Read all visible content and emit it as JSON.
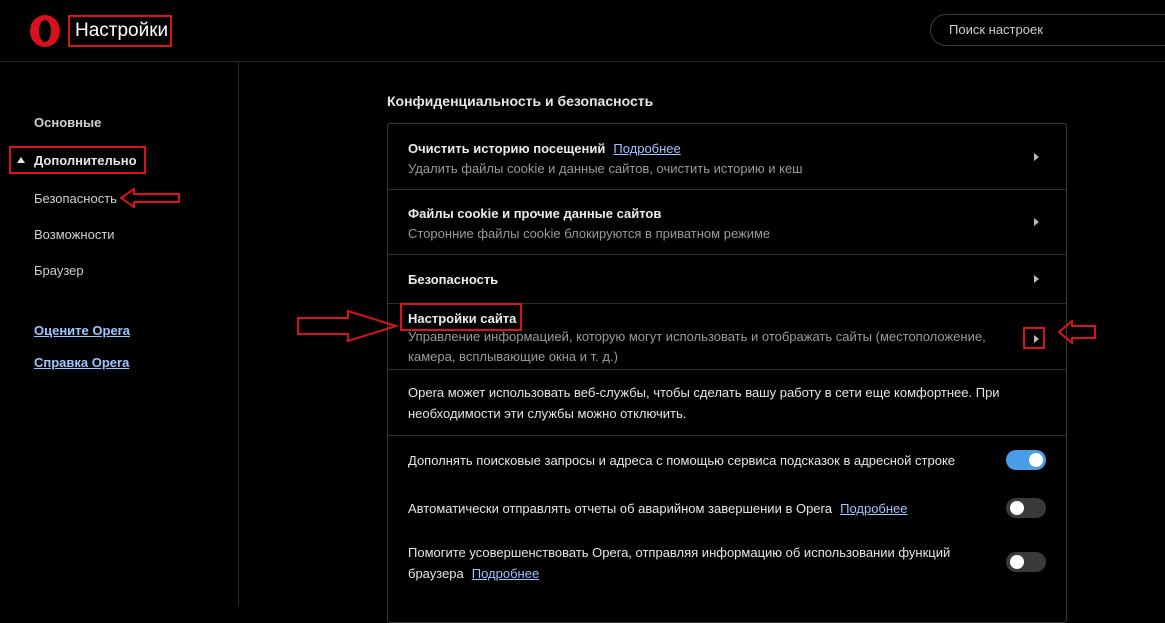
{
  "header": {
    "logo_icon": "opera-logo",
    "title": "Настройки",
    "search_placeholder": "Поиск настроек"
  },
  "sidebar": {
    "basic": "Основные",
    "advanced": "Дополнительно",
    "sub_items": [
      "Безопасность",
      "Возможности",
      "Браузер"
    ],
    "links": [
      "Оцените Opera",
      "Справка Opera"
    ]
  },
  "section": {
    "title": "Конфиденциальность и безопасность",
    "rows": {
      "clear_history": {
        "title": "Очистить историю посещений",
        "link": "Подробнее",
        "desc": "Удалить файлы cookie и данные сайтов, очистить историю и кеш"
      },
      "cookies": {
        "title": "Файлы cookie и прочие данные сайтов",
        "desc": "Сторонние файлы cookie блокируются в приватном режиме"
      },
      "security": {
        "title": "Безопасность"
      },
      "site_settings": {
        "title": "Настройки сайта",
        "desc_line1": "Управление информацией, которую могут использовать и отображать сайты (местоположение,",
        "desc_line2": "камера, всплывающие окна и т. д.)"
      },
      "web_services": {
        "line1": "Opera может использовать веб-службы, чтобы сделать вашу работу в сети еще комфортнее. При",
        "line2": "необходимости эти службы можно отключить."
      },
      "suggestions": {
        "text": "Дополнять поисковые запросы и адреса с помощью сервиса подсказок в адресной строке",
        "enabled": true
      },
      "crash_reports": {
        "text": "Автоматически отправлять отчеты об аварийном завершении в Opera",
        "link": "Подробнее",
        "enabled": false
      },
      "usage_info": {
        "line1": "Помогите усовершенствовать Opera, отправляя информацию об использовании функций",
        "line2": "браузера",
        "link": "Подробнее",
        "enabled": false
      }
    }
  },
  "colors": {
    "background": "#000000",
    "accent_red": "#d8121b",
    "link_blue": "#9dc5ff",
    "toggle_on": "#4a9ee8"
  }
}
